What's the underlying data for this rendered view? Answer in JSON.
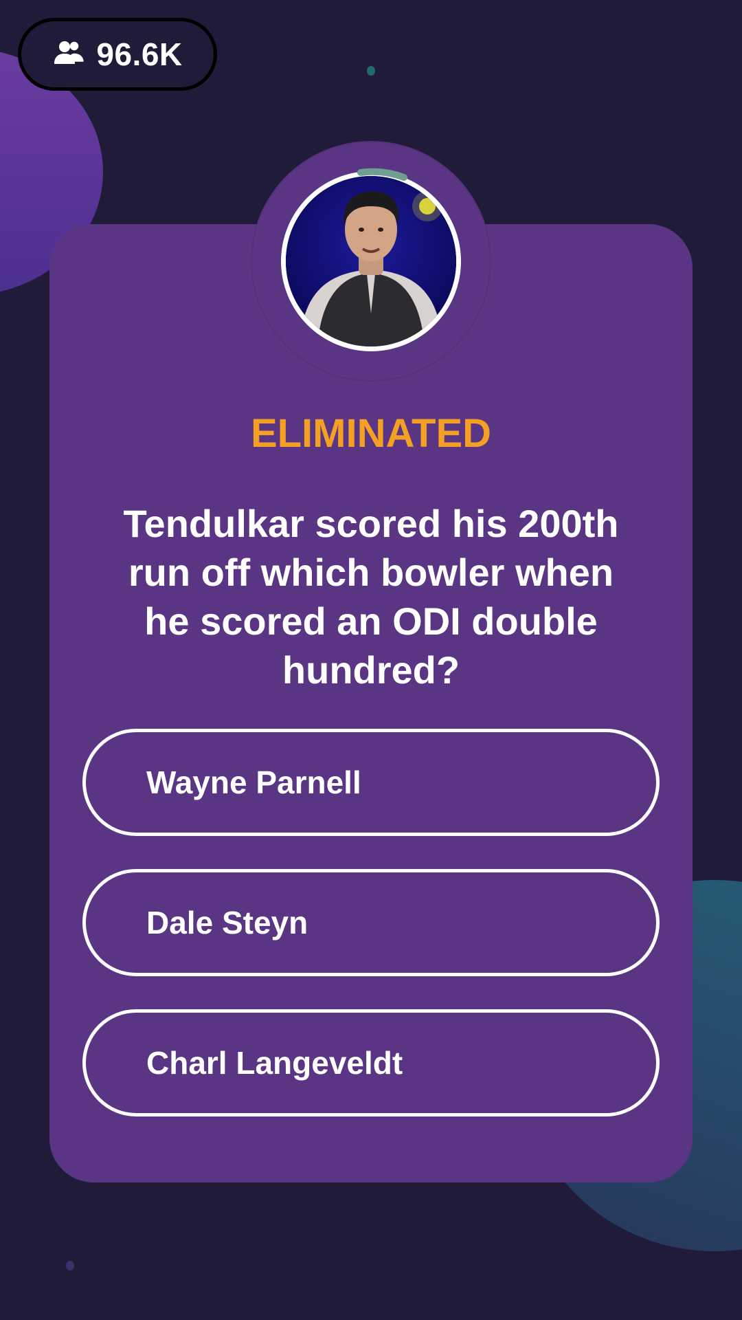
{
  "header": {
    "viewer_icon": "users-icon",
    "viewer_count": "96.6K"
  },
  "host": {
    "avatar_icon": "host-video-avatar"
  },
  "game": {
    "status": "ELIMINATED",
    "status_color": "#f4a024",
    "question": "Tendulkar scored his 200th run off which bowler when he scored an ODI double hundred?",
    "options": [
      {
        "label": "Wayne Parnell"
      },
      {
        "label": "Dale Steyn"
      },
      {
        "label": "Charl Langeveldt"
      }
    ]
  },
  "colors": {
    "background": "#1f1b38",
    "card": "#5a3583",
    "timer_arc": "#6f9e92"
  }
}
